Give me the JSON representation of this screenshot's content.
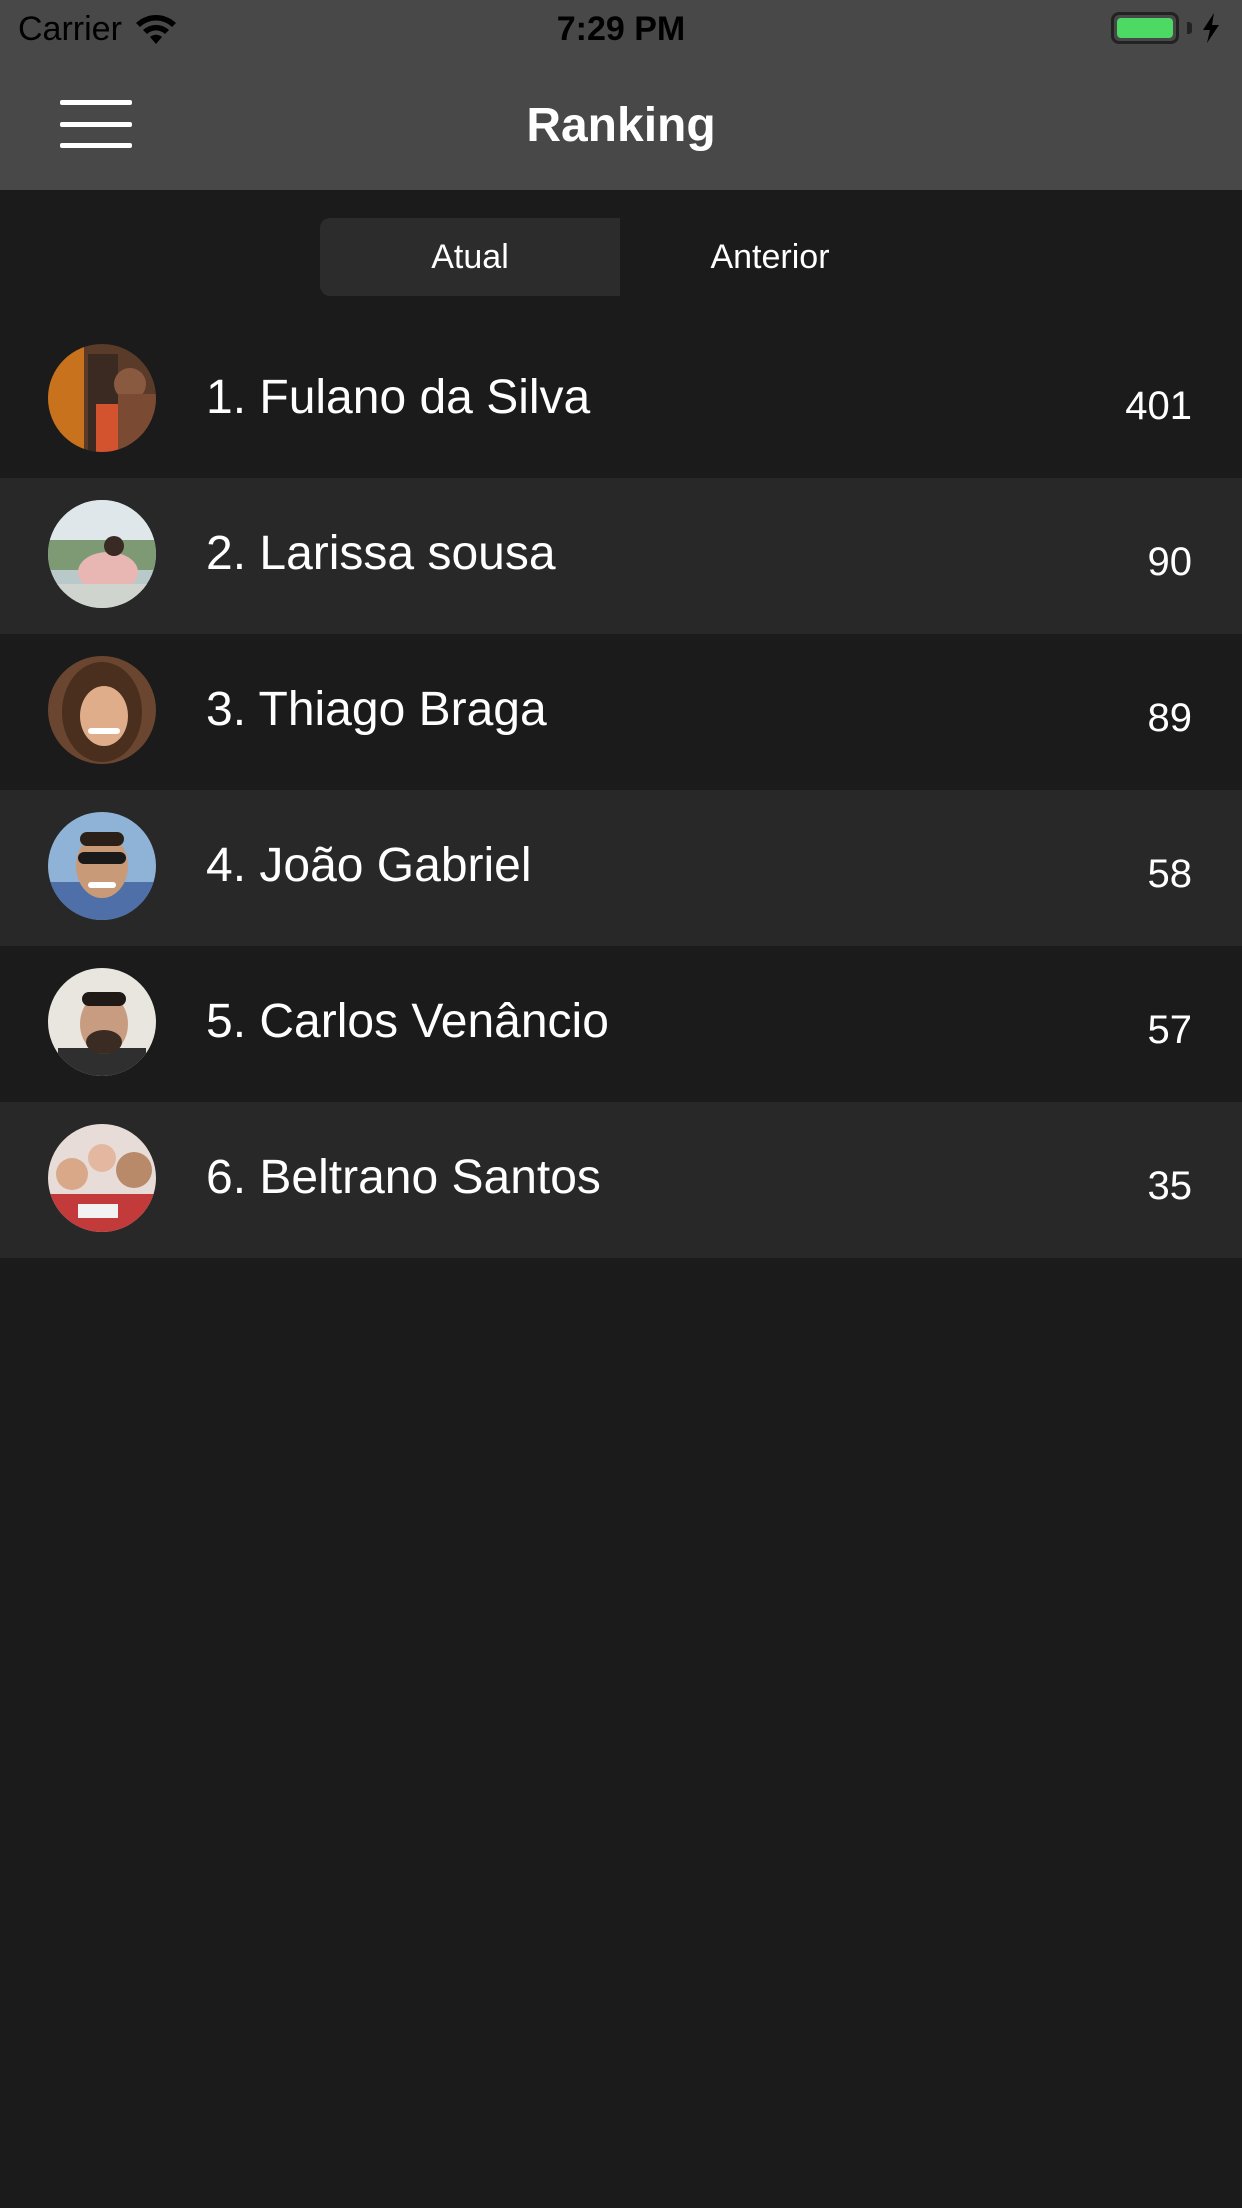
{
  "status_bar": {
    "carrier": "Carrier",
    "time": "7:29 PM",
    "wifi_icon": "wifi-icon",
    "battery_icon": "battery-icon",
    "charging_icon": "bolt-icon"
  },
  "nav": {
    "title": "Ranking",
    "menu_icon": "hamburger-menu-icon"
  },
  "tabs": [
    {
      "label": "Atual",
      "selected": true
    },
    {
      "label": "Anterior",
      "selected": false
    }
  ],
  "ranking": [
    {
      "name": "1. Fulano da Silva",
      "score": "401"
    },
    {
      "name": "2. Larissa sousa",
      "score": "90"
    },
    {
      "name": "3. Thiago Braga",
      "score": "89"
    },
    {
      "name": "4. João Gabriel",
      "score": "58"
    },
    {
      "name": "5. Carlos Venâncio",
      "score": "57"
    },
    {
      "name": "6. Beltrano Santos",
      "score": "35"
    }
  ],
  "colors": {
    "background": "#1b1b1b",
    "row_alt": "#282828",
    "nav_bar": "#484848",
    "segment_active": "#2c2c2c",
    "battery": "#4cd964"
  }
}
